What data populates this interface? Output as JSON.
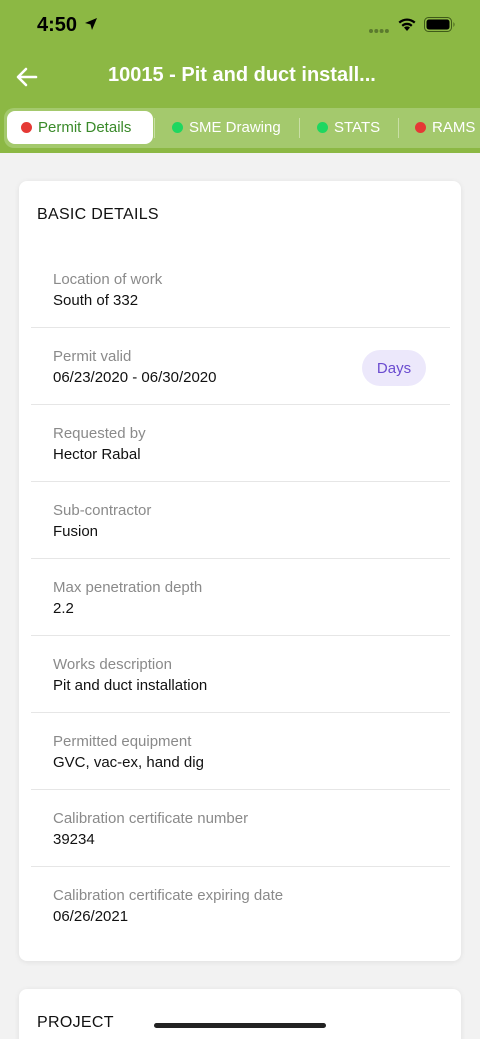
{
  "status_bar": {
    "time": "4:50"
  },
  "nav": {
    "title": "10015 - Pit and duct install..."
  },
  "tabs": [
    {
      "label": "Permit Details",
      "dot_color": "#e53935",
      "active": true
    },
    {
      "label": "SME Drawing",
      "dot_color": "#1ed760",
      "active": false
    },
    {
      "label": "STATS",
      "dot_color": "#1ed760",
      "active": false
    },
    {
      "label": "RAMS",
      "dot_color": "#e53935",
      "active": false
    }
  ],
  "basic_details": {
    "title": "BASIC DETAILS",
    "fields": [
      {
        "label": "Location of work",
        "value": "South of 332"
      },
      {
        "label": "Permit valid",
        "value": "06/23/2020 - 06/30/2020",
        "button": "Days"
      },
      {
        "label": "Requested by",
        "value": "Hector Rabal"
      },
      {
        "label": "Sub-contractor",
        "value": "Fusion"
      },
      {
        "label": "Max penetration depth",
        "value": "2.2"
      },
      {
        "label": "Works description",
        "value": "Pit and duct installation"
      },
      {
        "label": "Permitted equipment",
        "value": "GVC, vac-ex, hand dig"
      },
      {
        "label": "Calibration certificate number",
        "value": "39234"
      },
      {
        "label": "Calibration certificate expiring date",
        "value": "06/26/2021"
      }
    ]
  },
  "project": {
    "title": "PROJECT"
  },
  "colors": {
    "header": "#8cb844",
    "active_tab_text": "#3a8a2a",
    "pill_bg": "#ece8fb",
    "pill_text": "#6a4bd0"
  }
}
